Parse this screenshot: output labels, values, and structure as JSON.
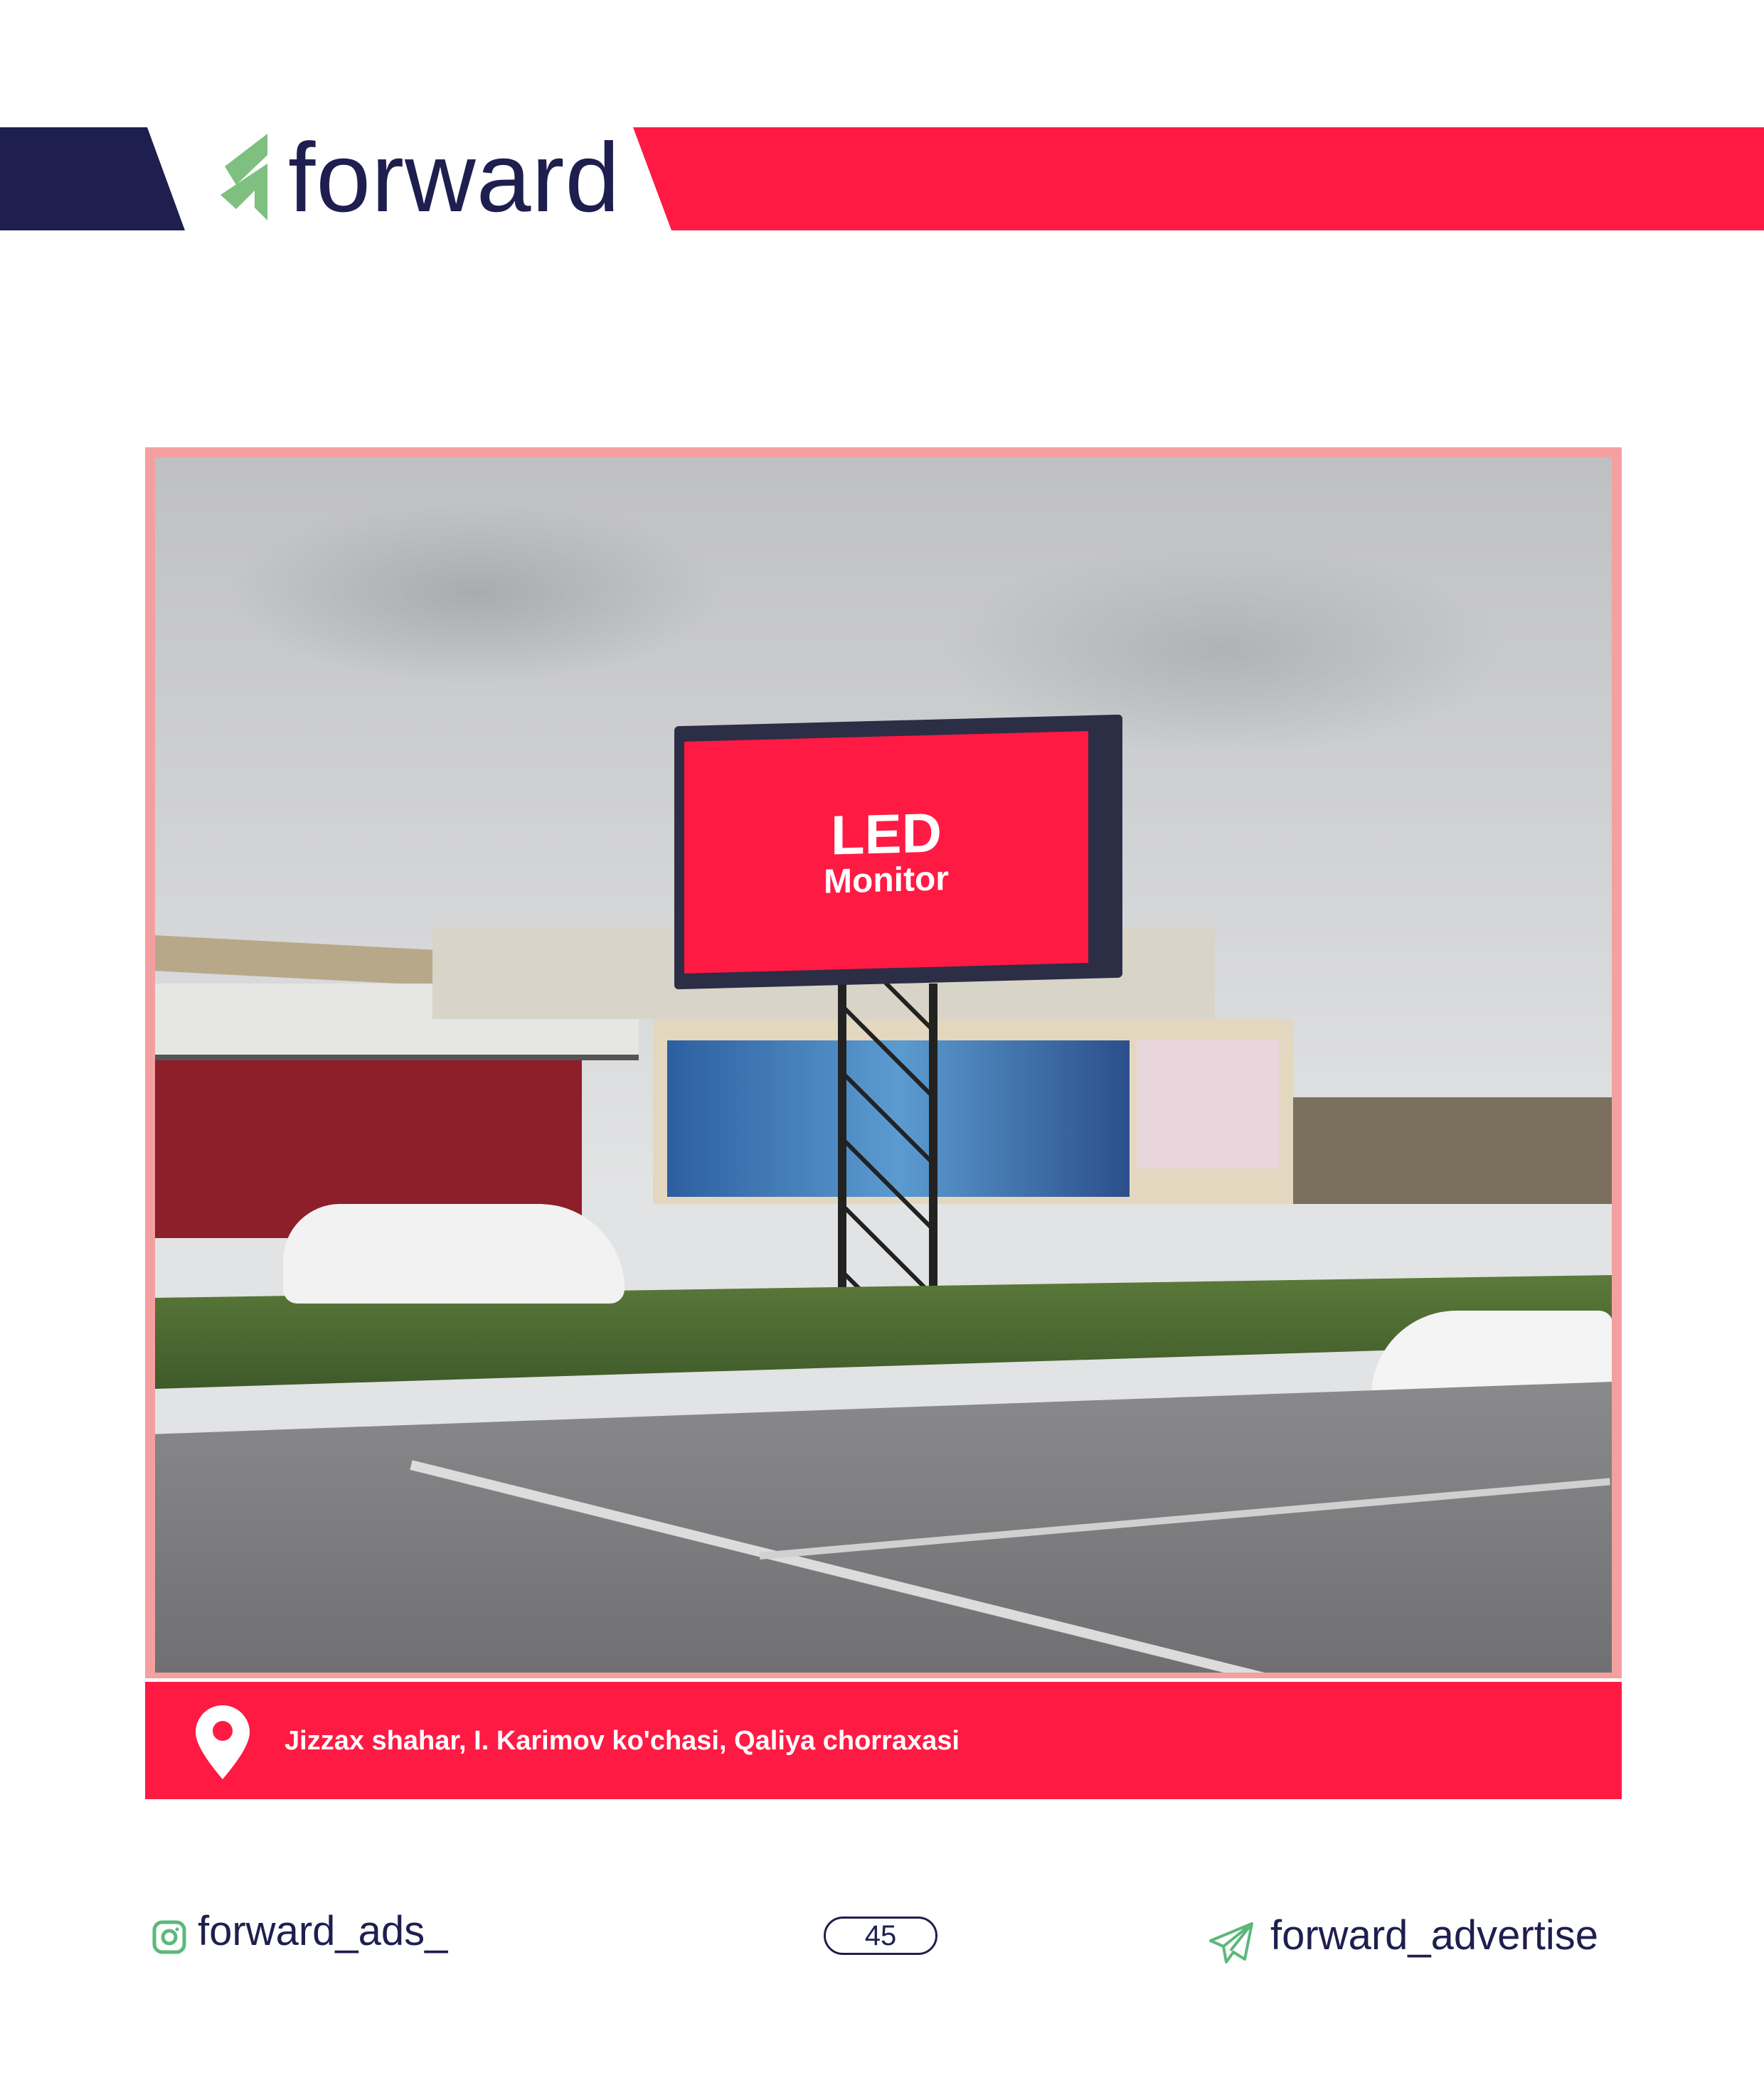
{
  "header": {
    "brand": "forward",
    "colors": {
      "navy": "#1e1f4f",
      "red": "#ff1a44",
      "green": "#7fbf7f"
    }
  },
  "photo": {
    "billboard": {
      "title": "LED",
      "subtitle": "Monitor"
    },
    "frame_color": "#f4a0a0"
  },
  "location": {
    "icon": "map-pin-icon",
    "address": "Jizzax shahar, I. Karimov ko'chasi, Qaliya chorraxasi"
  },
  "footer": {
    "instagram": {
      "icon": "instagram-icon",
      "handle": "forward_ads_"
    },
    "page_number": "45",
    "telegram": {
      "icon": "telegram-icon",
      "handle": "forward_advertise"
    }
  }
}
